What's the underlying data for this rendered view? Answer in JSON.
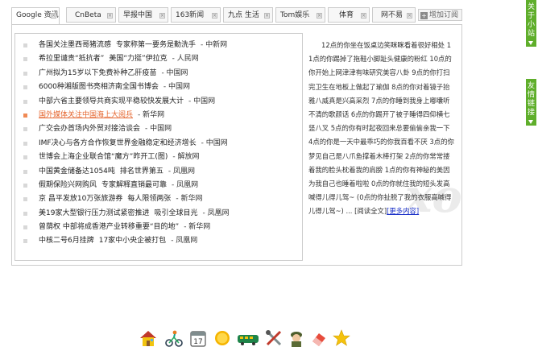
{
  "tabs": [
    {
      "label": "Google 资讯",
      "active": true
    },
    {
      "label": "CnBeta"
    },
    {
      "label": "早报中国"
    },
    {
      "label": "163新闻"
    },
    {
      "label": "九点 生活"
    },
    {
      "label": "Tom娱乐"
    },
    {
      "label": "体育"
    },
    {
      "label": "网不易"
    }
  ],
  "add_tab_label": "增加订阅",
  "news": [
    {
      "title": "各国关注墨西哥猪流感",
      "extra": "专家称第一要务是勤洗手",
      "source": "- 中新网"
    },
    {
      "title": "希拉里谴责“抵抗者”",
      "extra": "美国“力挺”伊拉克",
      "source": "- 人民网"
    },
    {
      "title": "广州拟为15岁以下免费补种乙肝疫苗",
      "extra": "",
      "source": "- 中国网"
    },
    {
      "title": "6000种湘版图书亮相济南全国书博会",
      "extra": "",
      "source": "- 中国网"
    },
    {
      "title": "中部六省主要领导共商实现平稳较快发展大计",
      "extra": "",
      "source": "- 中国网"
    },
    {
      "title": "国外媒体关注中国海上大阅兵",
      "extra": "",
      "source": "- 新华网",
      "highlight": true
    },
    {
      "title": "广交会办首场内外贸对接洽谈会",
      "extra": "",
      "source": "- 中国网"
    },
    {
      "title": "IMF决心与各方合作恢复世界金融稳定和经济增长",
      "extra": "",
      "source": "- 中国网"
    },
    {
      "title": "世博会上海企业联合馆“魔方”昨开工(图)",
      "extra": "",
      "source": "- 解放网"
    },
    {
      "title": "中国黄金储备达1054吨",
      "extra": "排名世界第五",
      "source": "- 凤凰网"
    },
    {
      "title": "假期保险兴网购风",
      "extra": "专家解释直销最可靠",
      "source": "- 凤凰网"
    },
    {
      "title": "京 昌平发放10万张旅游券",
      "extra": "每人限领两张",
      "source": "- 新华网"
    },
    {
      "title": "美19家大型银行压力测试紧密推进",
      "extra": "吸引全球目光",
      "source": "- 凤凰网"
    },
    {
      "title": "曾荫权 中部将成香港产业转移重要“目的地”",
      "extra": "",
      "source": "- 新华网"
    },
    {
      "title": "中核二号6月挂牌",
      "extra": "17家中小央企被打包",
      "source": "- 凤凰网"
    }
  ],
  "side_text": {
    "body": "12点的你坐在饭桌边笑眯眯看着很好相处 11点的你踢掉了拖鞋小脚趾头健康的粉红 10点的你开始上网津津有味研究美容八卦 9点的你打扫完卫生在地板上做起了瑜伽 8点的你对着镜子抬雅八威真是兴高采烈 7点的你睡到我身上嘟囔听不清的歌颜话 6点的你踢开了被子睡得四仰横七竖八叉 5点的你有时起夜回来总要偷偷亲我一下 4点的你是一天中最乖巧的你我百看不厌 3点的你梦见自己是八爪鱼撑着木棒打架 2点的你常常搂着我的脸头枕着我的肩膀 1点的你有神秘的美因为我自己也睡着啦啦 0点的你就住我的短头发高喊得儿得儿驾~ (0点的你扯脱了我的衣服高喊得儿得儿驾~) ...",
    "full_link": "[阅读全文]",
    "more_link": "[更多内容]",
    "watermark": "xo"
  },
  "right_tabs": [
    {
      "label": "关于小站"
    },
    {
      "label": "友情链接"
    }
  ],
  "dock_icons": [
    "home-icon",
    "cyclist-icon",
    "calendar-icon",
    "sun-icon",
    "train-icon",
    "tools-icon",
    "soldier-icon",
    "eraser-icon",
    "star-icon"
  ],
  "colors": {
    "accent_green": "#5fae2b",
    "link_blue": "#1a30c8",
    "highlight_orange": "#e5652e"
  }
}
